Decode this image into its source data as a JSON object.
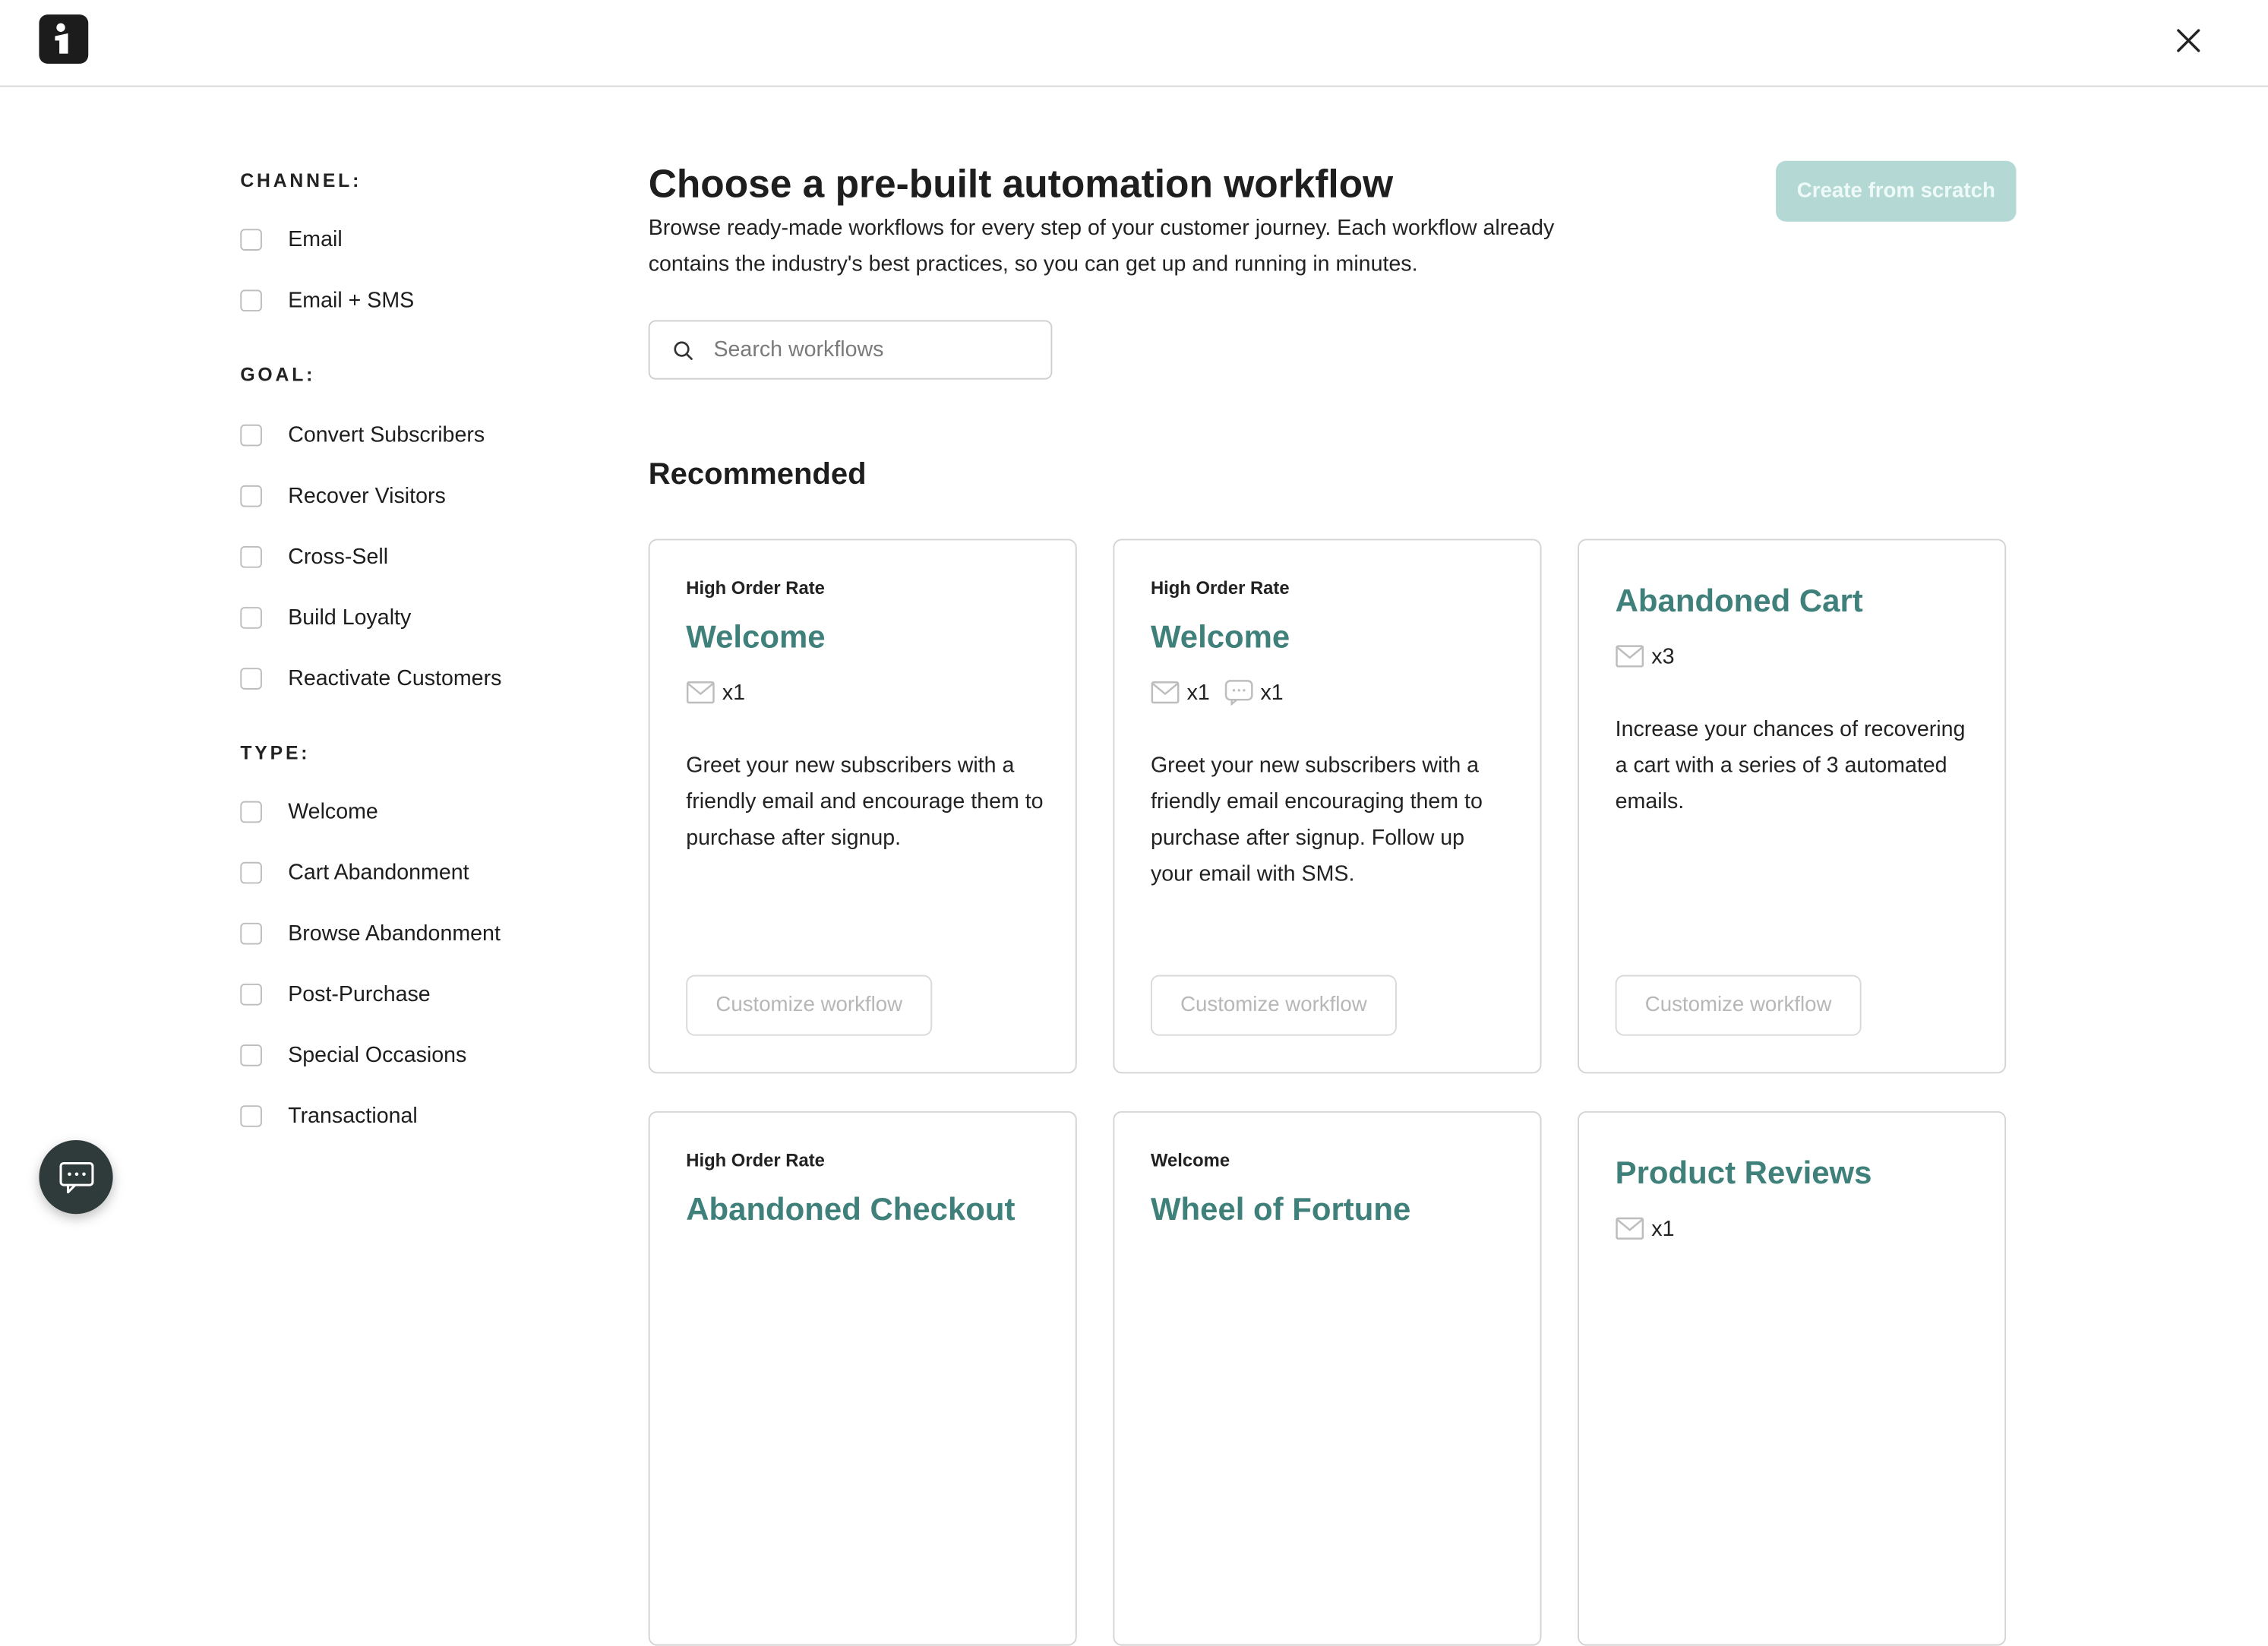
{
  "header": {
    "logo_icon": "brand-logo-icon",
    "close_icon": "close-icon"
  },
  "sidebar": {
    "channel": {
      "label": "CHANNEL:",
      "options": [
        "Email",
        "Email + SMS"
      ]
    },
    "goal": {
      "label": "GOAL:",
      "options": [
        "Convert Subscribers",
        "Recover Visitors",
        "Cross-Sell",
        "Build Loyalty",
        "Reactivate Customers"
      ]
    },
    "type": {
      "label": "TYPE:",
      "options": [
        "Welcome",
        "Cart Abandonment",
        "Browse Abandonment",
        "Post-Purchase",
        "Special Occasions",
        "Transactional"
      ]
    }
  },
  "main": {
    "title": "Choose a pre-built automation workflow",
    "subtitle": "Browse ready-made workflows for every step of your customer journey. Each workflow already contains the industry's best practices, so you can get up and running in minutes.",
    "create_button": "Create from scratch",
    "search": {
      "placeholder": "Search workflows",
      "value": ""
    },
    "section_title": "Recommended",
    "cards": [
      {
        "tag": "High Order Rate",
        "title": "Welcome",
        "counts": [
          {
            "icon": "email-icon",
            "label": "x1"
          }
        ],
        "description": "Greet your new subscribers with a friendly email and encourage them to purchase after signup.",
        "button": "Customize workflow"
      },
      {
        "tag": "High Order Rate",
        "title": "Welcome",
        "counts": [
          {
            "icon": "email-icon",
            "label": "x1"
          },
          {
            "icon": "sms-icon",
            "label": "x1"
          }
        ],
        "description": "Greet your new subscribers with a friendly email encouraging them to purchase after signup. Follow up your email with SMS.",
        "button": "Customize workflow"
      },
      {
        "tag": "",
        "title": "Abandoned Cart",
        "counts": [
          {
            "icon": "email-icon",
            "label": "x3"
          }
        ],
        "description": "Increase your chances of recovering a cart with a series of 3 automated emails.",
        "button": "Customize workflow"
      },
      {
        "tag": "High Order Rate",
        "title": "Abandoned Checkout",
        "counts": [],
        "description": "",
        "button": ""
      },
      {
        "tag": "Welcome",
        "title": "Wheel of Fortune",
        "counts": [],
        "description": "",
        "button": ""
      },
      {
        "tag": "",
        "title": "Product Reviews",
        "counts": [
          {
            "icon": "email-icon",
            "label": "x1"
          }
        ],
        "description": "",
        "button": ""
      }
    ]
  },
  "chat": {
    "icon": "chat-bubble-icon"
  },
  "colors": {
    "accent": "#3f807a",
    "create_button_bg": "#b4d8d3",
    "chat_button_bg": "#2f3a3a"
  }
}
